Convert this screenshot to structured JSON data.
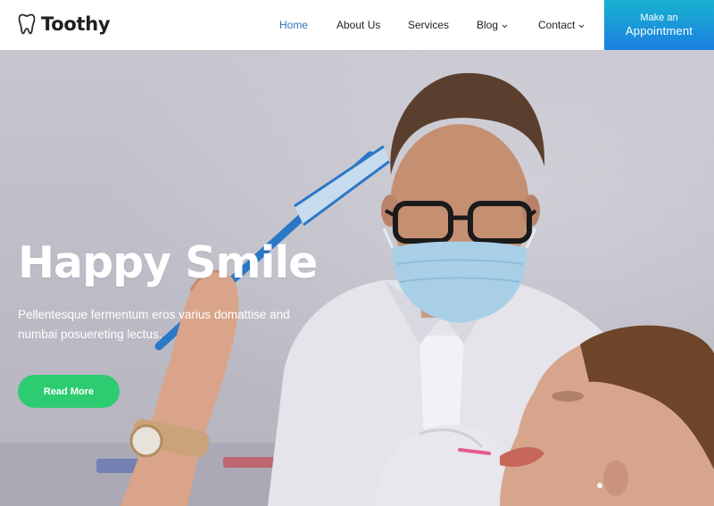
{
  "brand": {
    "name": "Toothy",
    "icon": "tooth-icon"
  },
  "nav": {
    "items": [
      {
        "label": "Home",
        "active": true,
        "dropdown": false
      },
      {
        "label": "About Us",
        "active": false,
        "dropdown": false
      },
      {
        "label": "Services",
        "active": false,
        "dropdown": false
      },
      {
        "label": "Blog",
        "active": false,
        "dropdown": true
      },
      {
        "label": "Contact",
        "active": false,
        "dropdown": true
      }
    ]
  },
  "cta": {
    "line1": "Make an",
    "line2": "Appointment"
  },
  "hero": {
    "title": "Happy Smile",
    "subtitle": "Pellentesque fermentum eros varius domattise and numbai posuereting lectus.",
    "button_label": "Read More",
    "image": "dentist-examining-patient-photo"
  },
  "colors": {
    "accent_blue": "#2f74c0",
    "cta_gradient_top": "#18b3d0",
    "cta_gradient_bottom": "#1c7fe0",
    "button_green": "#2ecc71"
  }
}
